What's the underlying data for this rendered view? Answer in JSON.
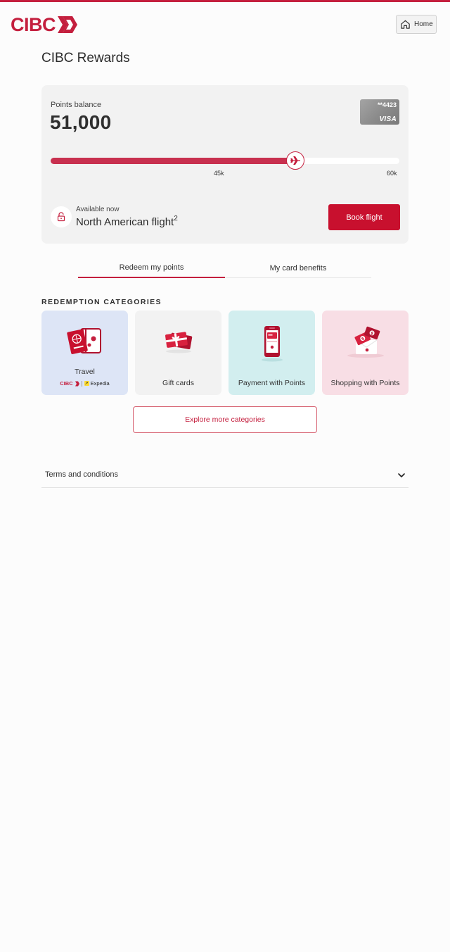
{
  "brand": {
    "logo_text": "CIBC",
    "accent": "#c41f3e",
    "button_red": "#c8102e"
  },
  "header": {
    "home_label": "Home"
  },
  "page": {
    "title": "CIBC Rewards"
  },
  "points": {
    "label": "Points balance",
    "value": "51,000",
    "progress_fraction": 0.701,
    "ticks": [
      {
        "label": "45k",
        "value": 45000
      },
      {
        "label": "60k",
        "value": 60000
      }
    ]
  },
  "card": {
    "number": "**4423",
    "network": "VISA"
  },
  "available": {
    "label": "Available now",
    "value": "North American flight",
    "footnote": "2",
    "button_label": "Book flight"
  },
  "tabs": [
    {
      "label": "Redeem my points",
      "active": true
    },
    {
      "label": "My card benefits",
      "active": false
    }
  ],
  "categories": {
    "heading": "REDEMPTION CATEGORIES",
    "items": [
      {
        "label": "Travel",
        "icon": "passport-luggage-icon",
        "color": "#dde5f6",
        "partner": {
          "cibc": "CIBC",
          "expedia": "Expedia"
        }
      },
      {
        "label": "Gift cards",
        "icon": "gift-cards-icon",
        "color": "#f2f2f2"
      },
      {
        "label": "Payment with Points",
        "icon": "phone-payment-icon",
        "color": "#d2eeef"
      },
      {
        "label": "Shopping with Points",
        "icon": "shopping-bag-icon",
        "color": "#f8dee5"
      }
    ],
    "explore_label": "Explore more categories"
  },
  "terms": {
    "label": "Terms and conditions"
  }
}
